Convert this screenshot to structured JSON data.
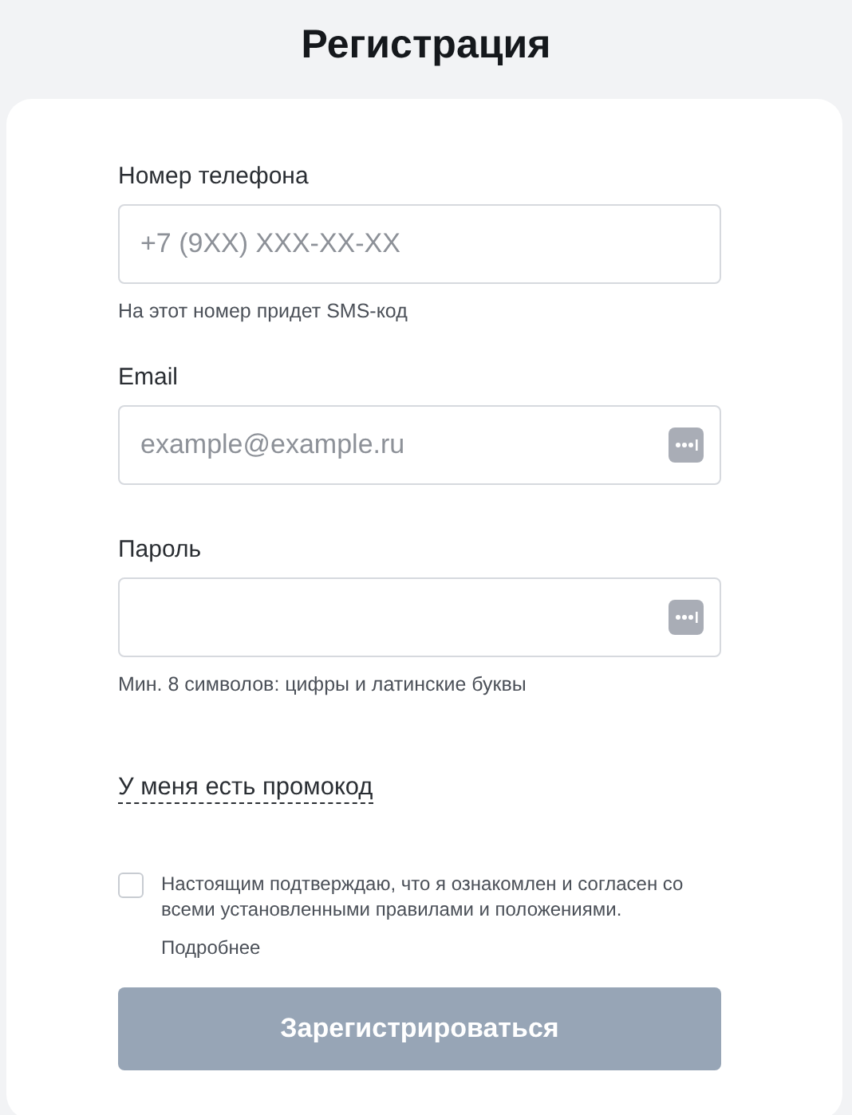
{
  "title": "Регистрация",
  "fields": [
    {
      "label": "Номер телефона",
      "placeholder": "+7 (9XX) XXX-XX-XX",
      "autofill_icon": false,
      "hint": "На этот номер придет SMS-код"
    },
    {
      "label": "Email",
      "placeholder": "example@example.ru",
      "autofill_icon": true
    },
    {
      "label": "Пароль",
      "autofill_icon": true,
      "hint": "Мин. 8 символов: цифры и латинские буквы"
    }
  ],
  "promo_link": "У меня есть промокод",
  "consent": {
    "checked": false,
    "text": "Настоящим подтверждаю, что я ознакомлен и согласен со всеми установленными правилами и положениями.",
    "link": "Подробнее"
  },
  "submit": {
    "label": "Зарегистрироваться",
    "disabled": true
  }
}
